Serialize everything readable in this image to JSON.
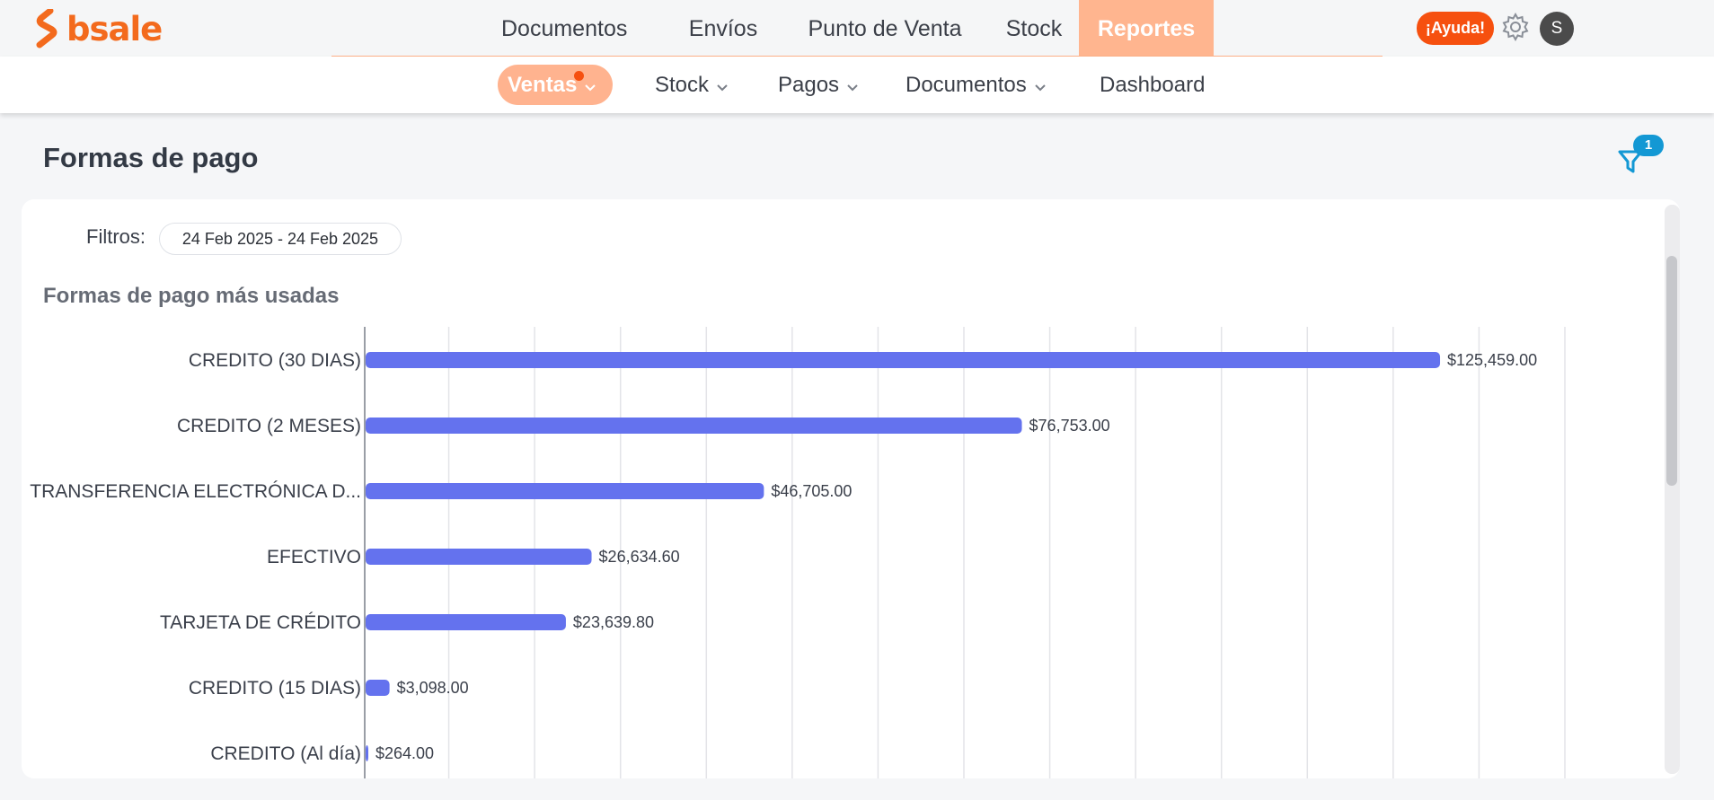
{
  "brand": {
    "name": "bsale",
    "color": "#f36a1d"
  },
  "main_nav": {
    "items": [
      {
        "label": "Documentos",
        "active": false
      },
      {
        "label": "Envíos",
        "active": false
      },
      {
        "label": "Punto de Venta",
        "active": false
      },
      {
        "label": "Stock",
        "active": false
      },
      {
        "label": "Reportes",
        "active": true
      }
    ]
  },
  "header_actions": {
    "help_label": "¡Ayuda!",
    "avatar_initial": "S",
    "settings_icon": "gear-icon"
  },
  "sub_nav": {
    "items": [
      {
        "label": "Ventas",
        "active": true,
        "has_dropdown": true,
        "has_notification": true
      },
      {
        "label": "Stock",
        "active": false,
        "has_dropdown": true
      },
      {
        "label": "Pagos",
        "active": false,
        "has_dropdown": true
      },
      {
        "label": "Documentos",
        "active": false,
        "has_dropdown": true
      },
      {
        "label": "Dashboard",
        "active": false,
        "has_dropdown": false
      }
    ]
  },
  "page": {
    "title": "Formas de pago",
    "filter_count": "1"
  },
  "filters": {
    "label": "Filtros:",
    "date_range": "24 Feb 2025 - 24 Feb 2025"
  },
  "chart_data": {
    "type": "bar",
    "orientation": "horizontal",
    "title": "Formas de pago más usadas",
    "categories": [
      "CREDITO (30 DIAS)",
      "CREDITO (2 MESES)",
      "TRANSFERENCIA ELECTRÓNICA D...",
      "EFECTIVO",
      "TARJETA DE CRÉDITO",
      "CREDITO (15 DIAS)",
      "CREDITO (Al día)"
    ],
    "values": [
      125459.0,
      76753.0,
      46705.0,
      26634.6,
      23639.8,
      3098.0,
      264.0
    ],
    "value_labels": [
      "$125,459.00",
      "$76,753.00",
      "$46,705.00",
      "$26,634.60",
      "$23,639.80",
      "$3,098.00",
      "$264.00"
    ],
    "xlim": [
      0,
      140000
    ],
    "grid": true,
    "bar_color": "#6472ee"
  }
}
